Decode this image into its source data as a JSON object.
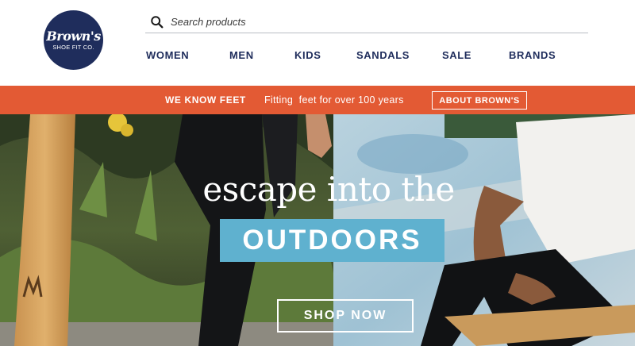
{
  "logo": {
    "line1": "Brown's",
    "line2": "SHOE FIT CO."
  },
  "search": {
    "placeholder": "Search products",
    "icon": "search-icon"
  },
  "nav": {
    "items": [
      {
        "label": "WOMEN"
      },
      {
        "label": "MEN"
      },
      {
        "label": "KIDS"
      },
      {
        "label": "SANDALS"
      },
      {
        "label": "SALE"
      },
      {
        "label": "BRANDS"
      }
    ]
  },
  "promo": {
    "title": "WE KNOW FEET",
    "text": "Fitting  feet for over 100 years",
    "button_label": "ABOUT BROWN'S"
  },
  "hero": {
    "headline": "escape into the",
    "badge": "OUTDOORS",
    "cta_label": "SHOP NOW"
  },
  "colors": {
    "brand_navy": "#1f2d5c",
    "promo_orange": "#e35a34",
    "badge_blue": "#5fb1cf"
  }
}
